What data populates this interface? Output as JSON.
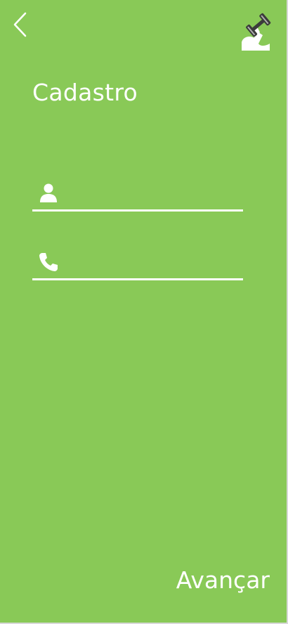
{
  "header": {
    "back_icon": "chevron-left-icon",
    "logo_icon": "flexed-arm-dumbbell-icon"
  },
  "main": {
    "title": "Cadastro",
    "fields": [
      {
        "icon": "user-icon",
        "value": "",
        "placeholder": ""
      },
      {
        "icon": "phone-icon",
        "value": "",
        "placeholder": ""
      }
    ]
  },
  "footer": {
    "next_label": "Avançar"
  },
  "colors": {
    "background": "#89c957",
    "foreground": "#ffffff",
    "logo_dumbbell": "#3b3b3b"
  }
}
